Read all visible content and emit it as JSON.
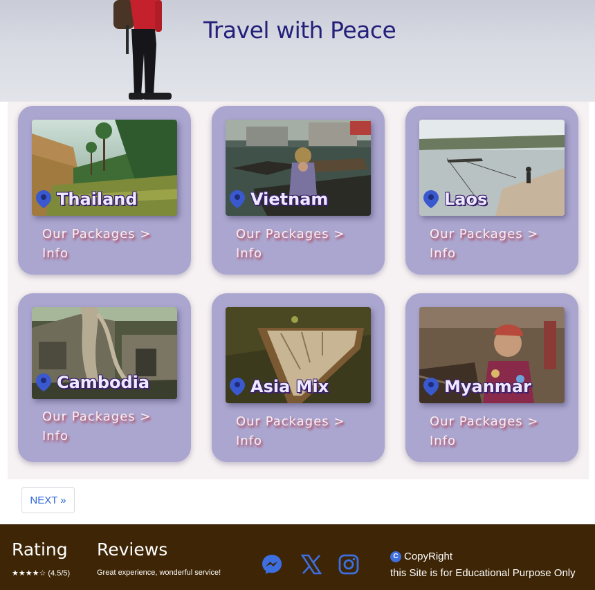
{
  "hero": {
    "title": "Travel with Peace"
  },
  "destinations": [
    {
      "name": "Thailand",
      "packages": "Our Packages >",
      "info": "Info"
    },
    {
      "name": "Vietnam",
      "packages": "Our Packages >",
      "info": "Info"
    },
    {
      "name": "Laos",
      "packages": "Our Packages >",
      "info": "Info"
    },
    {
      "name": "Cambodia",
      "packages": "Our Packages >",
      "info": "Info"
    },
    {
      "name": "Asia Mix",
      "packages": "Our Packages >",
      "info": "Info"
    },
    {
      "name": "Myanmar",
      "packages": "Our Packages >",
      "info": "Info"
    }
  ],
  "pagination": {
    "next_label": "NEXT »"
  },
  "footer": {
    "rating_heading": "Rating",
    "rating_value": "★★★★☆ (4.5/5)",
    "reviews_heading": "Reviews",
    "reviews_text": "Great experience, wonderful service!",
    "social_icons": [
      "messenger-icon",
      "x-icon",
      "instagram-icon"
    ],
    "copyright": "CopyRight",
    "purpose": "this Site is for Educational Purpose Only"
  },
  "colors": {
    "card_bg": "#aaa6cf",
    "footer_bg": "#3d2505",
    "title": "#24207a",
    "social": "#3d6fe0"
  }
}
